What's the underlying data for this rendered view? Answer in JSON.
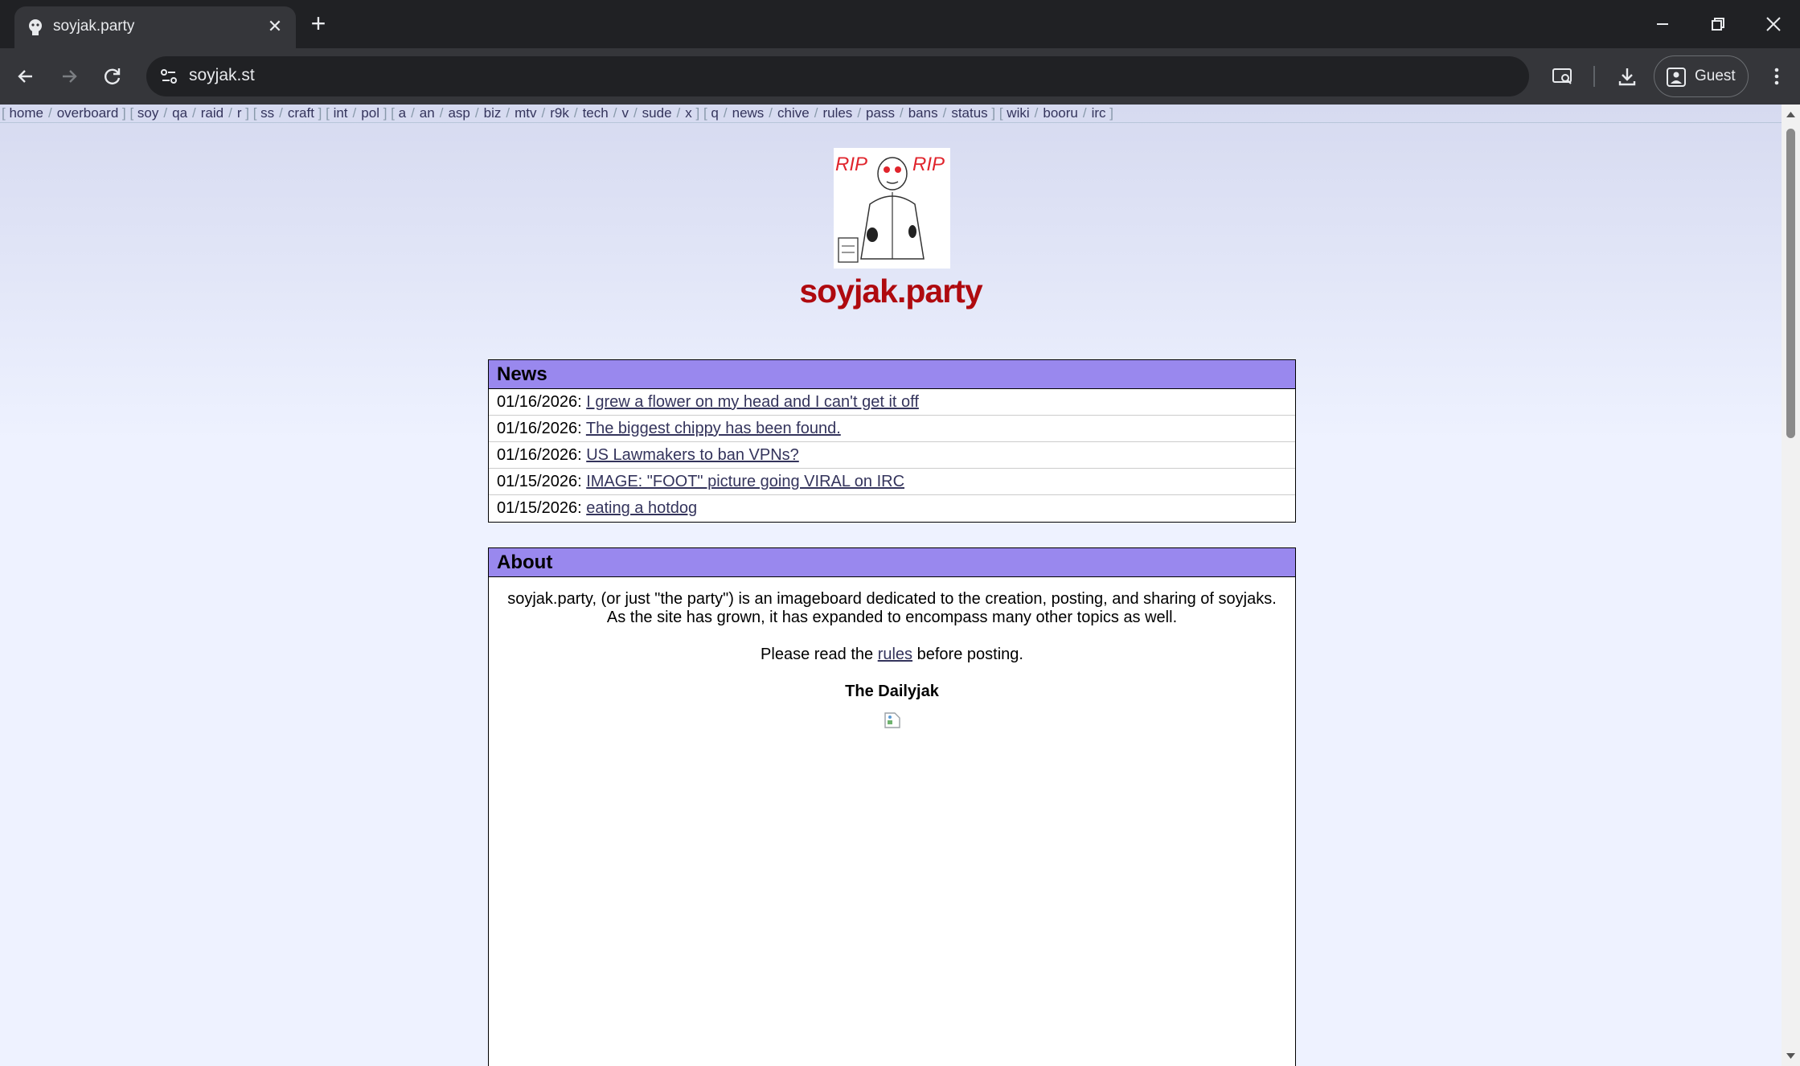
{
  "browser": {
    "tab_title": "soyjak.party",
    "url": "soyjak.st",
    "profile_label": "Guest"
  },
  "boardlist": [
    [
      "home",
      "overboard"
    ],
    [
      "soy",
      "qa",
      "raid",
      "r"
    ],
    [
      "ss",
      "craft"
    ],
    [
      "int",
      "pol"
    ],
    [
      "a",
      "an",
      "asp",
      "biz",
      "mtv",
      "r9k",
      "tech",
      "v",
      "sude",
      "x"
    ],
    [
      "q",
      "news",
      "chive",
      "rules",
      "pass",
      "bans",
      "status"
    ],
    [
      "wiki",
      "booru",
      "irc"
    ]
  ],
  "logo": {
    "text_left": "RIP",
    "text_right": "RIP"
  },
  "site_title": "soyjak.party",
  "news": {
    "header": "News",
    "items": [
      {
        "date": "01/16/2026:",
        "title": "I grew a flower on my head and I can't get it off"
      },
      {
        "date": "01/16/2026:",
        "title": "The biggest chippy has been found."
      },
      {
        "date": "01/16/2026:",
        "title": "US Lawmakers to ban VPNs?"
      },
      {
        "date": "01/15/2026:",
        "title": "IMAGE: \"FOOT\" picture going VIRAL on IRC"
      },
      {
        "date": "01/15/2026:",
        "title": "eating a hotdog"
      }
    ]
  },
  "about": {
    "header": "About",
    "line1": "soyjak.party, (or just \"the party\") is an imageboard dedicated to the creation, posting, and sharing of soyjaks.",
    "line2": "As the site has grown, it has expanded to encompass many other topics as well.",
    "rules_prefix": "Please read the ",
    "rules_link": "rules",
    "rules_suffix": " before posting.",
    "daily_title": "The Dailyjak"
  },
  "colors": {
    "title_red": "#af0a0f",
    "header_purple": "#9988ee",
    "link": "#34345c"
  }
}
